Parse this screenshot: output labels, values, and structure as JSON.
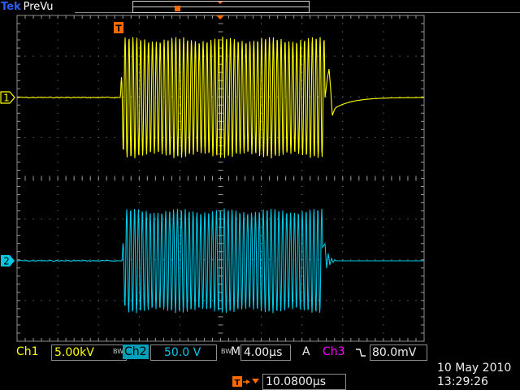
{
  "header": {
    "brand": "Tek",
    "mode": "PreVu"
  },
  "channels": [
    {
      "marker": "1",
      "label": "Ch1",
      "scale": "5.00kV",
      "color": "#ffff00"
    },
    {
      "marker": "2",
      "label": "Ch2",
      "scale": "50.0 V",
      "bw_limit": "BW",
      "color": "#00c8e6"
    }
  ],
  "horizontal": {
    "bw_limit": "BW",
    "label": "M",
    "scale": "4.00µs"
  },
  "trigger": {
    "marker": "T",
    "label": "A",
    "source": "Ch3",
    "slope": "falling",
    "level": "80.0mV",
    "position": "10.0800µs",
    "color": "#ff6a00",
    "source_color": "#ff00ff"
  },
  "date": "10 May 2010",
  "time": "13:29:26",
  "colors": {
    "graticule": "#9a9a9a",
    "trigger_marker": "#ff6a00",
    "ch3": "#ff00ff"
  }
}
